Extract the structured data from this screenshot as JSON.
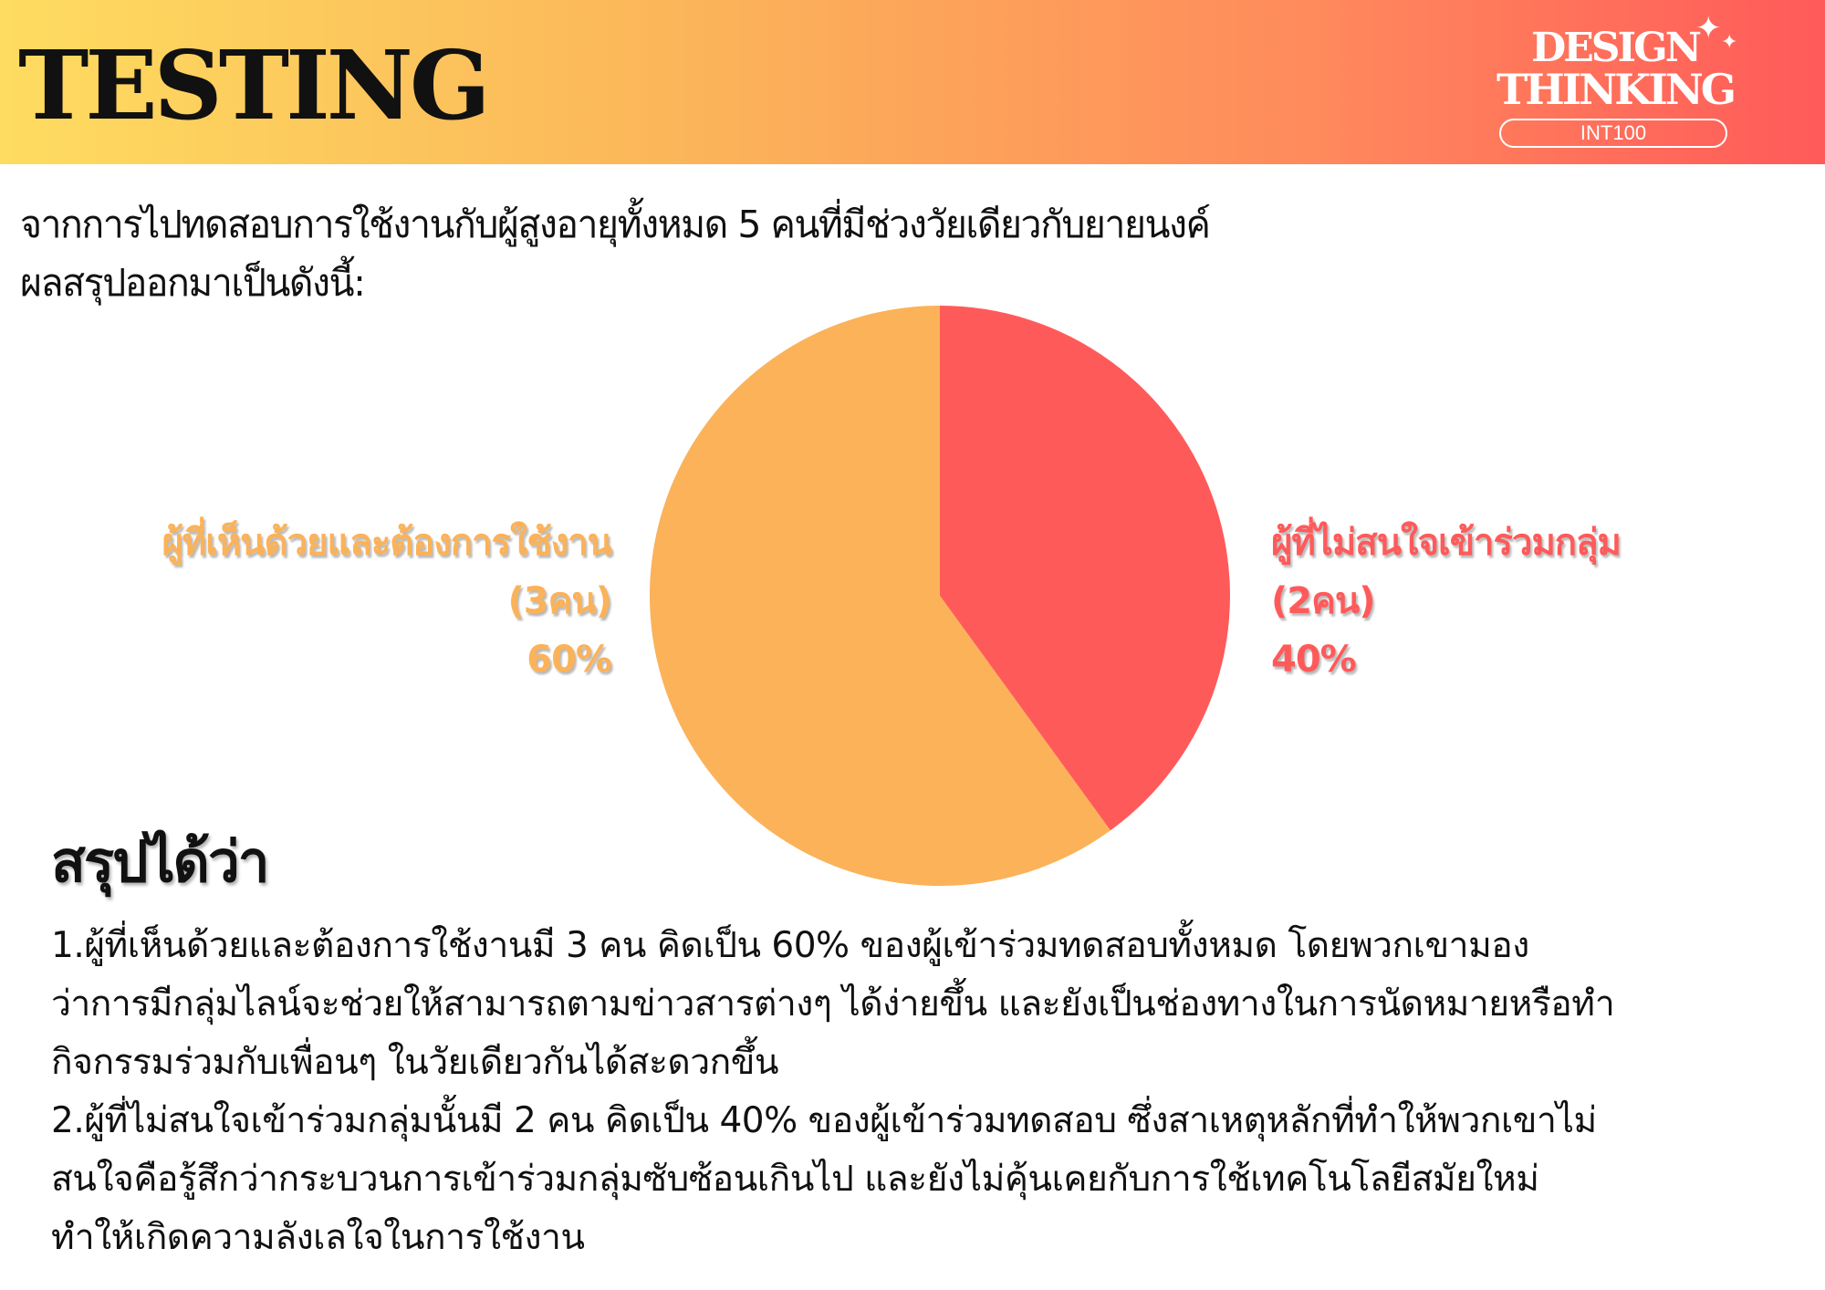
{
  "header": {
    "title": "TESTING",
    "logo": {
      "line1": "DESIGN",
      "line2": "THINKING",
      "course": "INT100"
    }
  },
  "intro": {
    "line1": "จากการไปทดสอบการใช้งานกับผู้สูงอายุทั้งหมด 5 คนที่มีช่วงวัยเดียวกับยายนงค์",
    "line2": "ผลสรุปออกมาเป็นดังนี้:"
  },
  "chart_data": {
    "type": "pie",
    "slices": [
      {
        "label": "ผู้ที่ไม่สนใจเข้าร่วมกลุ่ม",
        "count_text": "(2คน)",
        "count": 2,
        "value": 40,
        "percent_text": "40%",
        "color": "#ff5a5a"
      },
      {
        "label": "ผู้ที่เห็นด้วยและต้องการใช้งาน",
        "count_text": "(3คน)",
        "count": 3,
        "value": 60,
        "percent_text": "60%",
        "color": "#fbb259"
      }
    ],
    "start": "12 o'clock",
    "direction": "clockwise",
    "legend": "none (labels beside slices)"
  },
  "conclusion": {
    "title": "สรุปได้ว่า",
    "lines": [
      "1.ผู้ที่เห็นด้วยและต้องการใช้งานมี 3 คน คิดเป็น 60% ของผู้เข้าร่วมทดสอบทั้งหมด โดยพวกเขามอง",
      "ว่าการมีกลุ่มไลน์จะช่วยให้สามารถตามข่าวสารต่างๆ ได้ง่ายขึ้น และยังเป็นช่องทางในการนัดหมายหรือทำ",
      "กิจกรรมร่วมกับเพื่อนๆ ในวัยเดียวกันได้สะดวกขึ้น",
      "2.ผู้ที่ไม่สนใจเข้าร่วมกลุ่มนั้นมี 2 คน คิดเป็น 40% ของผู้เข้าร่วมทดสอบ ซึ่งสาเหตุหลักที่ทำให้พวกเขาไม่",
      "สนใจคือรู้สึกว่ากระบวนการเข้าร่วมกลุ่มซับซ้อนเกินไป และยังไม่คุ้นเคยกับการใช้เทคโนโลยีสมัยใหม่",
      "ทำให้เกิดความลังเลใจในการใช้งาน"
    ]
  }
}
